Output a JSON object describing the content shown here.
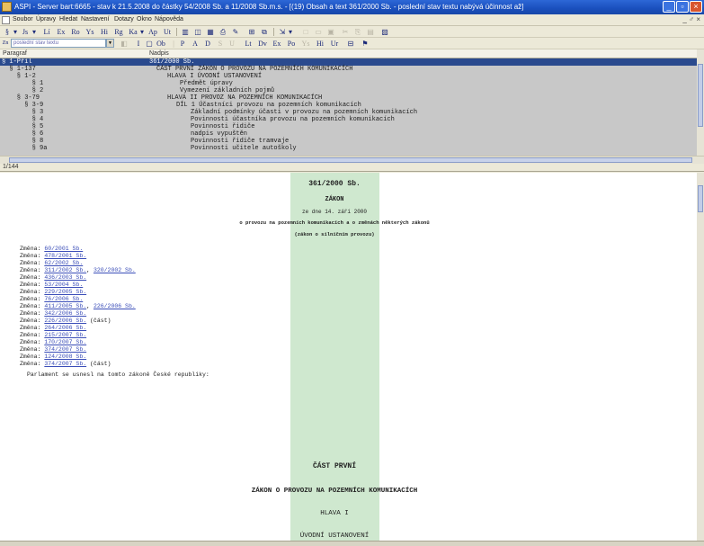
{
  "window": {
    "title": "ASPI - Server bart:6665 - stav k 21.5.2008 do částky 54/2008 Sb. a 11/2008 Sb.m.s. - [(19) Obsah a text 361/2000 Sb. - poslední stav textu nabývá účinnost až]"
  },
  "menu": {
    "items": [
      "Soubor",
      "Úpravy",
      "Hledat",
      "Nastavení",
      "Dotazy",
      "Okno",
      "Nápověda"
    ],
    "right_controls": "_ ♂ ×"
  },
  "toolbar1": {
    "buttons": [
      "§",
      "Js",
      "Lí",
      "Ex",
      "Ro",
      "Ys",
      "Hi",
      "Rg",
      "Ka",
      "Ap",
      "Ut"
    ]
  },
  "toolbar2": {
    "search_label": "Zn",
    "search_placeholder": "poslední stav textu",
    "buttons": [
      "I",
      "Ob",
      "P",
      "A",
      "D",
      "S",
      "U",
      "Lt",
      "Dv",
      "Ex",
      "Po",
      "Ys",
      "Hi",
      "Ur"
    ]
  },
  "tree": {
    "col_paragraf": "Paragraf",
    "col_nadpis": "Nadpis",
    "rows": [
      {
        "par": "§ 1-Příl",
        "title": "361/2000 Sb.",
        "selected": true
      },
      {
        "par": "  § 1-137",
        "title": "ČÁST PRVNÍ ZÁKON O PROVOZU NA POZEMNÍCH KOMUNIKACÍCH",
        "selected": false
      },
      {
        "par": "    § 1-2",
        "title": "HLAVA I ÚVODNÍ USTANOVENÍ",
        "selected": false
      },
      {
        "par": "        § 1",
        "title": "Předmět úpravy",
        "selected": false
      },
      {
        "par": "        § 2",
        "title": "Vymezení základních pojmů",
        "selected": false
      },
      {
        "par": "    § 3-79",
        "title": "HLAVA II PROVOZ NA POZEMNÍCH KOMUNIKACÍCH",
        "selected": false
      },
      {
        "par": "      § 3-9",
        "title": "DÍL 1 Účastníci provozu na pozemních komunikacích",
        "selected": false
      },
      {
        "par": "        § 3",
        "title": "Základní podmínky účasti v provozu na pozemních komunikacích",
        "selected": false
      },
      {
        "par": "        § 4",
        "title": "Povinnosti účastníka provozu na pozemních komunikacích",
        "selected": false
      },
      {
        "par": "        § 5",
        "title": "Povinnosti řidiče",
        "selected": false
      },
      {
        "par": "        § 6",
        "title": "nadpis vypuštěn",
        "selected": false
      },
      {
        "par": "        § 8",
        "title": "Povinnosti řidiče tramvaje",
        "selected": false
      },
      {
        "par": "        § 9a",
        "title": "Povinnosti učitele autoškoly",
        "selected": false
      }
    ]
  },
  "status": {
    "position": "1/144"
  },
  "document": {
    "number": "361/2000 Sb.",
    "heading": "ZÁKON",
    "date": "ze dne 14. září 2000",
    "subject": "o provozu na pozemních komunikacích a o změnách některých zákonů",
    "short_name": "(zákon o silničním provozu)",
    "changes_label": "Změna:",
    "changes": [
      {
        "links": [
          "60/2001 Sb."
        ],
        "note": ""
      },
      {
        "links": [
          "478/2001 Sb."
        ],
        "note": ""
      },
      {
        "links": [
          "62/2002 Sb."
        ],
        "note": ""
      },
      {
        "links": [
          "311/2002 Sb.",
          "320/2002 Sb."
        ],
        "note": ""
      },
      {
        "links": [
          "436/2003 Sb."
        ],
        "note": ""
      },
      {
        "links": [
          "53/2004 Sb."
        ],
        "note": ""
      },
      {
        "links": [
          "229/2005 Sb."
        ],
        "note": ""
      },
      {
        "links": [
          "76/2006 Sb."
        ],
        "note": ""
      },
      {
        "links": [
          "411/2005 Sb.",
          "226/2006 Sb."
        ],
        "note": ""
      },
      {
        "links": [
          "342/2006 Sb."
        ],
        "note": ""
      },
      {
        "links": [
          "226/2006 Sb."
        ],
        "note": "(část)"
      },
      {
        "links": [
          "264/2006 Sb."
        ],
        "note": ""
      },
      {
        "links": [
          "215/2007 Sb."
        ],
        "note": ""
      },
      {
        "links": [
          "170/2007 Sb."
        ],
        "note": ""
      },
      {
        "links": [
          "374/2007 Sb."
        ],
        "note": ""
      },
      {
        "links": [
          "124/2008 Sb."
        ],
        "note": ""
      },
      {
        "links": [
          "374/2007 Sb."
        ],
        "note": "(část)"
      }
    ],
    "preamble": "Parlament se usnesl na tomto zákoně České republiky:",
    "part": "ČÁST PRVNÍ",
    "part_title": "ZÁKON O PROVOZU NA POZEMNÍCH KOMUNIKACÍCH",
    "chapter": "HLAVA I",
    "chapter_title": "ÚVODNÍ USTANOVENÍ"
  }
}
